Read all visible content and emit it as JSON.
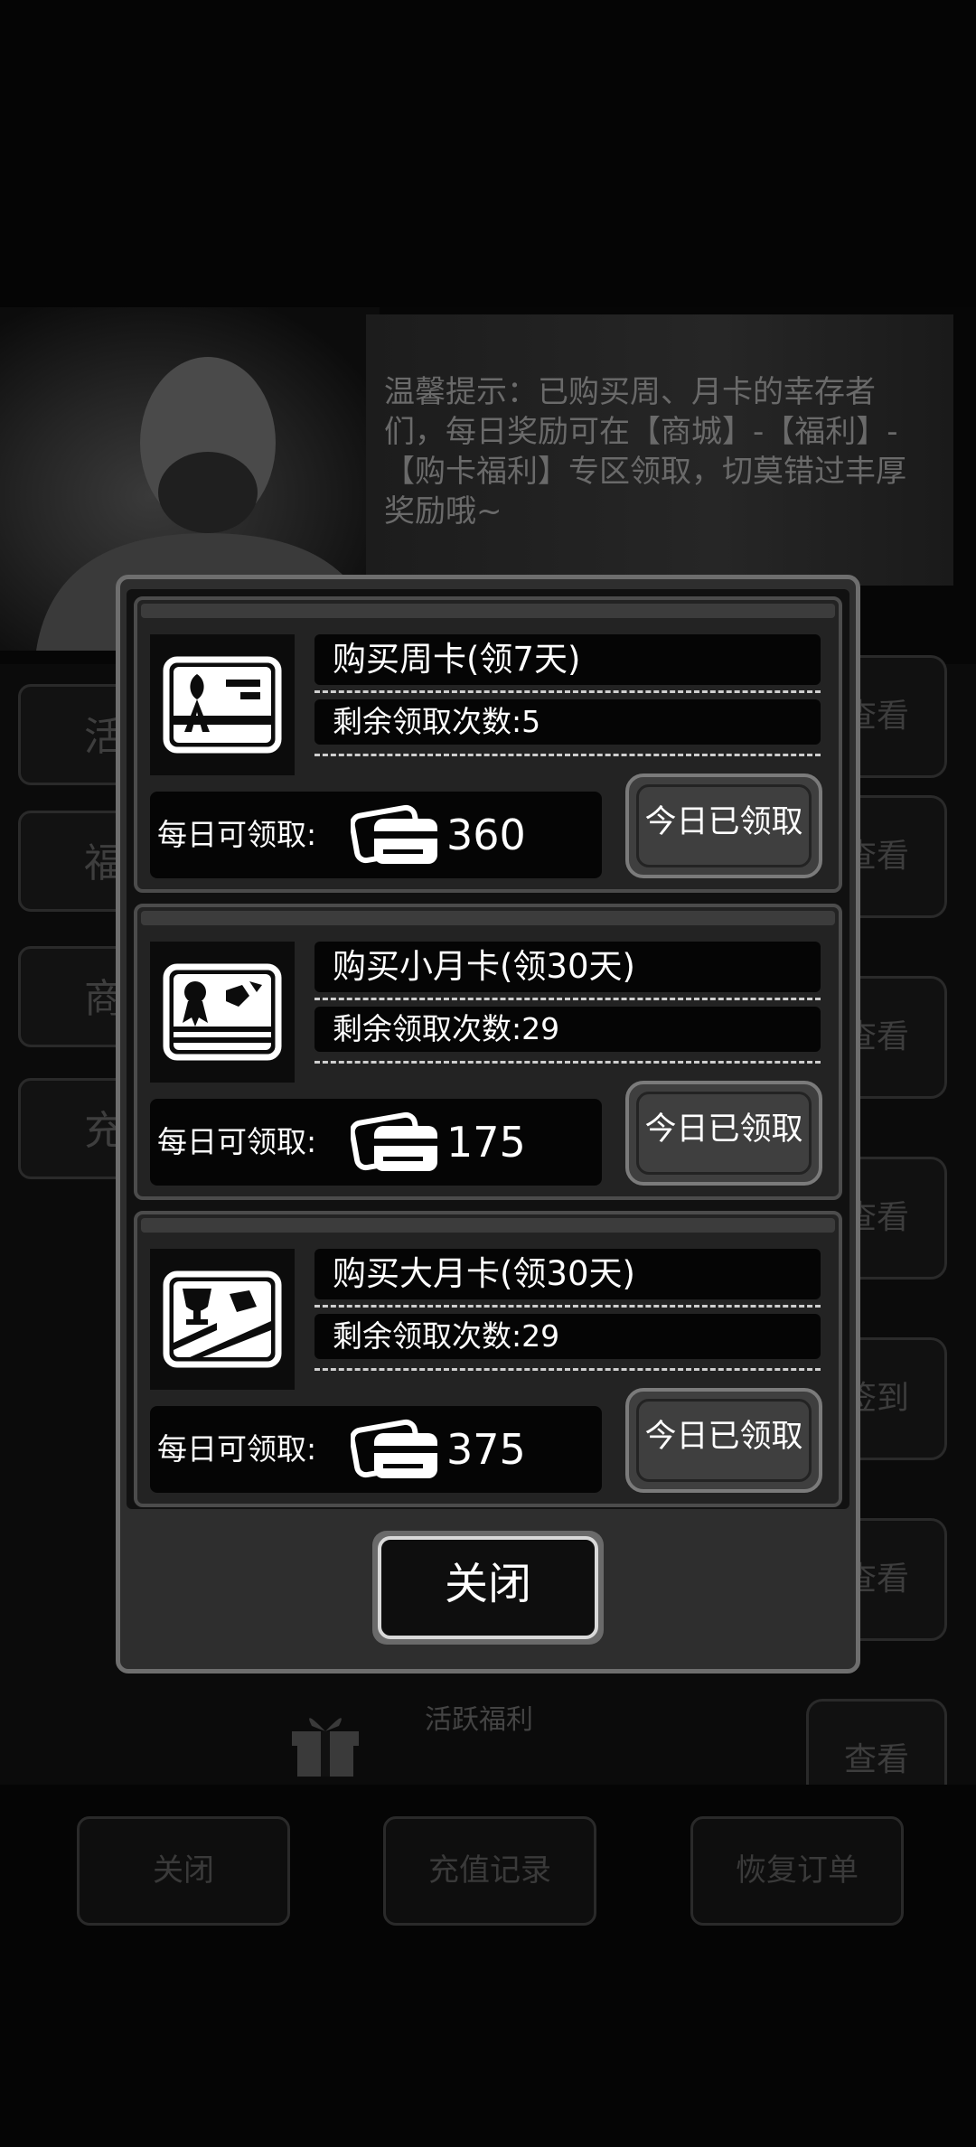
{
  "background": {
    "tip": "温馨提示：已购买周、月卡的幸存者们，每日奖励可在【商城】-【福利】-【购卡福利】专区领取，切莫错过丰厚奖励哦~",
    "tabs": [
      "活",
      "福",
      "商",
      "充"
    ],
    "side_buttons": [
      "查看",
      "查看",
      "查看",
      "查看",
      "签到",
      "查看",
      "查看"
    ],
    "active_row_title": "活跃福利",
    "bottom_buttons": [
      "关闭",
      "充值记录",
      "恢复订单"
    ]
  },
  "modal": {
    "cards": [
      {
        "title": "购买周卡(领7天)",
        "remaining": "剩余领取次数:5",
        "daily_label": "每日可领取:",
        "daily_amount": "360",
        "claim_label": "今日已领取",
        "icon": "ribbon-card-icon"
      },
      {
        "title": "购买小月卡(领30天)",
        "remaining": "剩余领取次数:29",
        "daily_label": "每日可领取:",
        "daily_amount": "175",
        "claim_label": "今日已领取",
        "icon": "medal-card-icon"
      },
      {
        "title": "购买大月卡(领30天)",
        "remaining": "剩余领取次数:29",
        "daily_label": "每日可领取:",
        "daily_amount": "375",
        "claim_label": "今日已领取",
        "icon": "trophy-card-icon"
      }
    ],
    "close_label": "关闭"
  }
}
